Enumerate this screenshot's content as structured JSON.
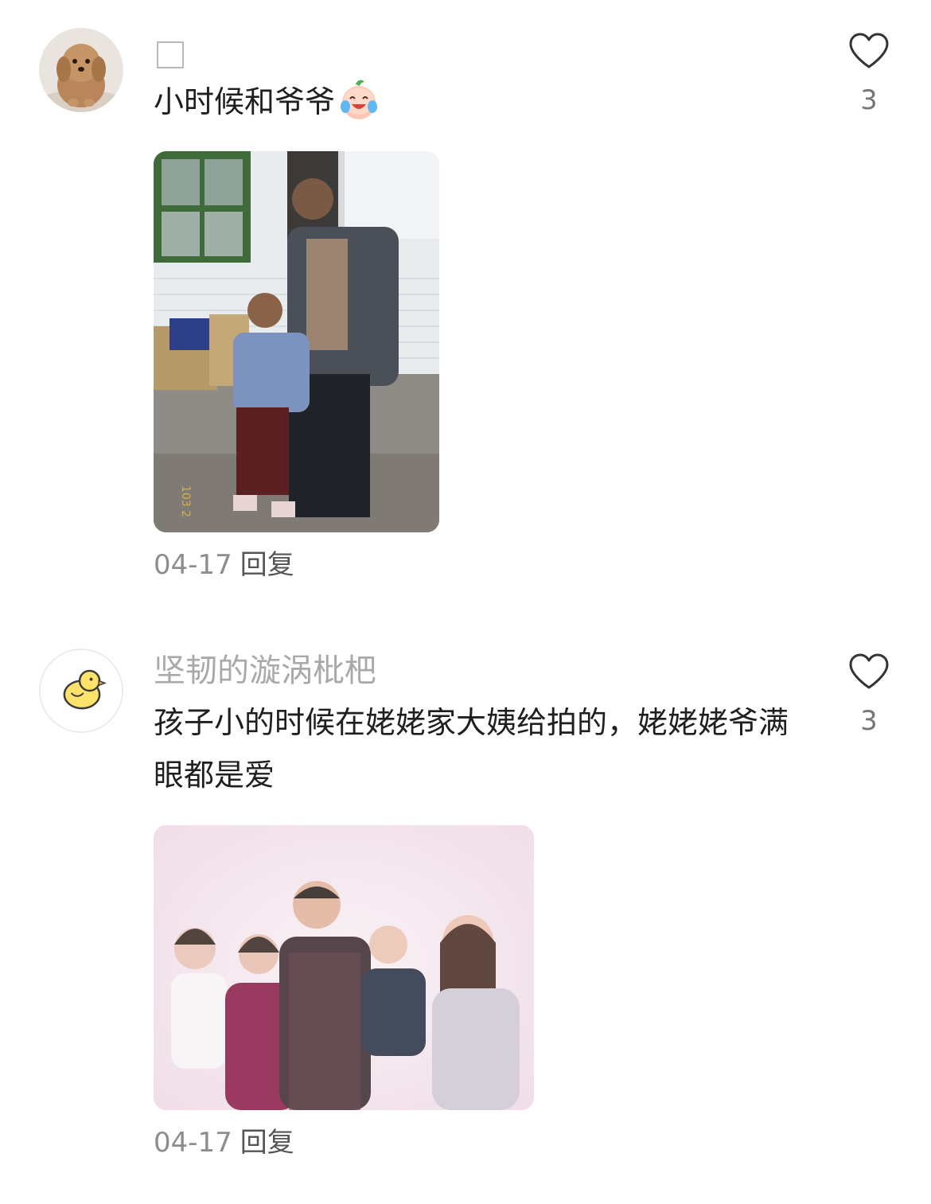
{
  "comments": [
    {
      "username": "",
      "text": "小时候和爷爷",
      "emoji": "crying-laughing-peach-emoji",
      "date": "04-17",
      "reply_label": "回复",
      "likes": "3",
      "avatar": "poodle-dog-avatar",
      "photo": "child-with-grandfather-photo",
      "photo_date_stamp": "103 2"
    },
    {
      "username": "坚韧的漩涡枇杷",
      "text": "孩子小的时候在姥姥家大姨给拍的，姥姥姥爷满眼都是爱",
      "date": "04-17",
      "reply_label": "回复",
      "likes": "3",
      "avatar": "yellow-chick-avatar",
      "photo": "family-group-photo"
    }
  ],
  "colors": {
    "text": "#1f1f1f",
    "username": "#a9a9a9",
    "meta": "#8d8d8d",
    "icon": "#333333",
    "background": "#ffffff"
  },
  "icons": {
    "like": "heart-outline-icon"
  }
}
